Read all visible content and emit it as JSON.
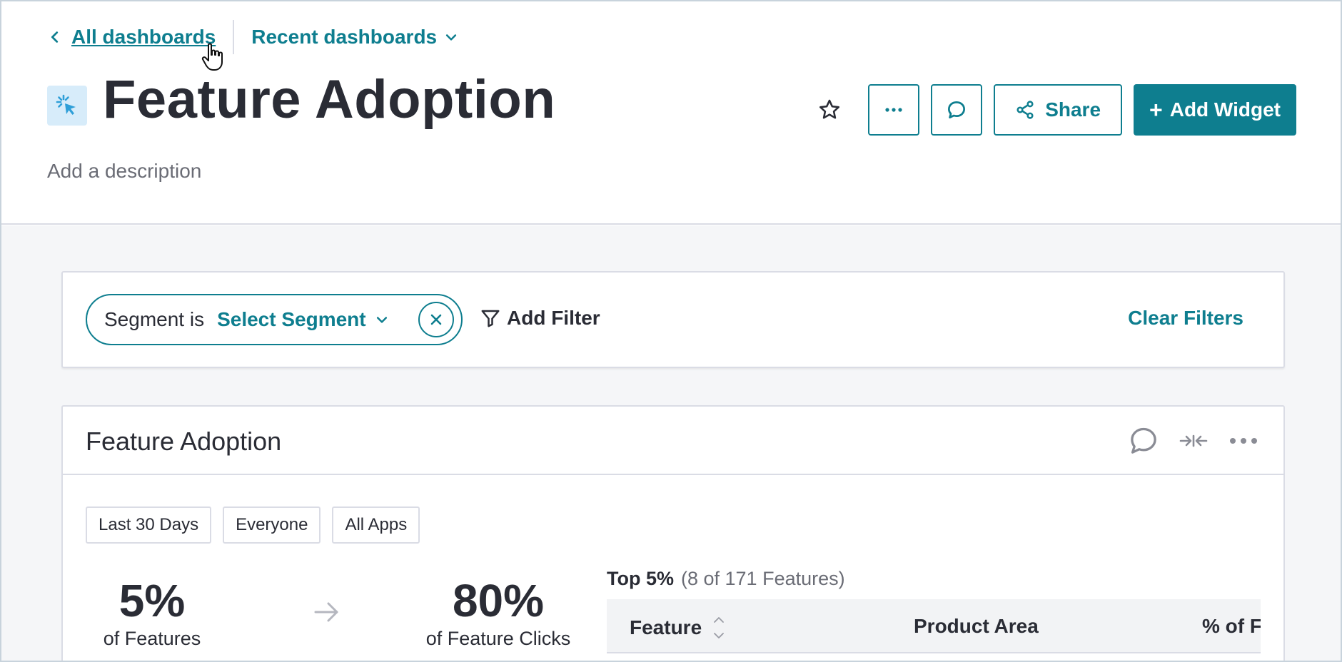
{
  "breadcrumb": {
    "back_label": "All dashboards",
    "recent_label": "Recent dashboards"
  },
  "header": {
    "title": "Feature Adoption",
    "description_placeholder": "Add a description",
    "icon": "cursor-click-icon"
  },
  "actions": {
    "more_label": "···",
    "share_label": "Share",
    "add_widget_label": "+ Add Widget",
    "add_widget_text": "Add Widget"
  },
  "filters": {
    "segment_label": "Segment is",
    "segment_value": "Select Segment",
    "add_filter_label": "Add Filter",
    "clear_label": "Clear Filters"
  },
  "widget": {
    "title": "Feature Adoption",
    "chips": [
      "Last 30 Days",
      "Everyone",
      "All Apps"
    ],
    "stat_features": {
      "value": "5%",
      "label": "of Features"
    },
    "stat_clicks": {
      "value": "80%",
      "label": "of Feature Clicks"
    },
    "top_caption_bold": "Top 5%",
    "top_caption_muted": "(8 of 171 Features)",
    "columns": [
      "Feature",
      "Product Area",
      "% of Fe"
    ]
  },
  "colors": {
    "accent": "#0e7e8f",
    "text": "#2a2c35",
    "muted": "#6a6c75",
    "border": "#dadce5"
  }
}
